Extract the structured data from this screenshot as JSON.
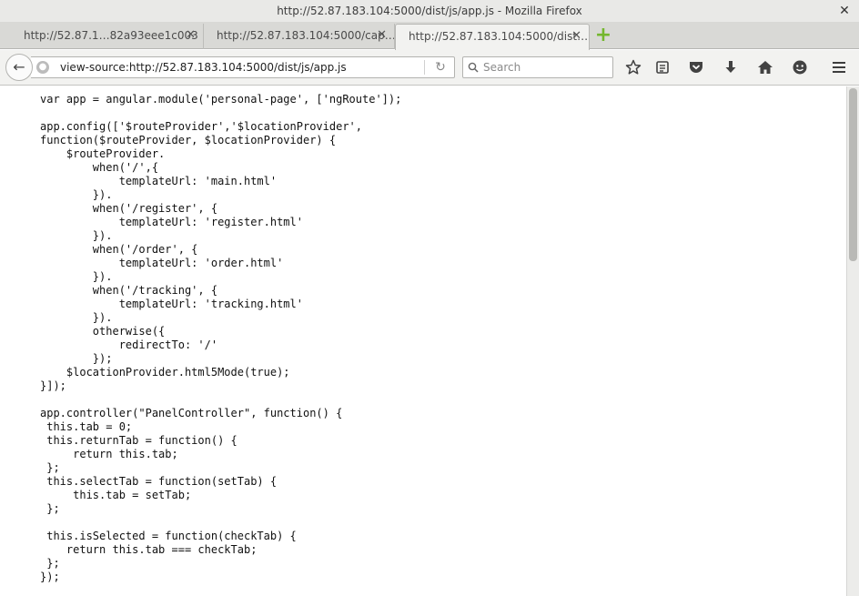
{
  "window": {
    "title": "http://52.87.183.104:5000/dist/js/app.js - Mozilla Firefox",
    "close_glyph": "✕"
  },
  "tabs": [
    {
      "label": "http://52.87.1…82a93eee1c003",
      "close_glyph": "✕",
      "active": false
    },
    {
      "label": "http://52.87.183.104:5000/cap…",
      "close_glyph": "✕",
      "active": false
    },
    {
      "label": "http://52.87.183.104:5000/dist…",
      "close_glyph": "✕",
      "active": true
    }
  ],
  "new_tab": {
    "glyph": "+"
  },
  "navbar": {
    "back_glyph": "←",
    "url": "view-source:http://52.87.183.104:5000/dist/js/app.js",
    "reload_glyph": "↻",
    "search_placeholder": "Search",
    "icons": [
      "bookmark-star-icon",
      "reading-list-icon",
      "pocket-icon",
      "download-icon",
      "home-icon",
      "hello-icon",
      "menu-icon"
    ]
  },
  "source_code": "var app = angular.module('personal-page', ['ngRoute']);\n\napp.config(['$routeProvider','$locationProvider',\nfunction($routeProvider, $locationProvider) {\n    $routeProvider.\n        when('/',{\n            templateUrl: 'main.html'\n        }).\n        when('/register', {\n            templateUrl: 'register.html'\n        }).\n        when('/order', {\n            templateUrl: 'order.html'\n        }).\n        when('/tracking', {\n            templateUrl: 'tracking.html'\n        }).\n        otherwise({\n            redirectTo: '/'\n        });\n    $locationProvider.html5Mode(true);\n}]);\n\napp.controller(\"PanelController\", function() {\n this.tab = 0;\n this.returnTab = function() {\n     return this.tab;\n };\n this.selectTab = function(setTab) {\n     this.tab = setTab;\n };\n\n this.isSelected = function(checkTab) {\n    return this.tab === checkTab;\n };\n});"
}
